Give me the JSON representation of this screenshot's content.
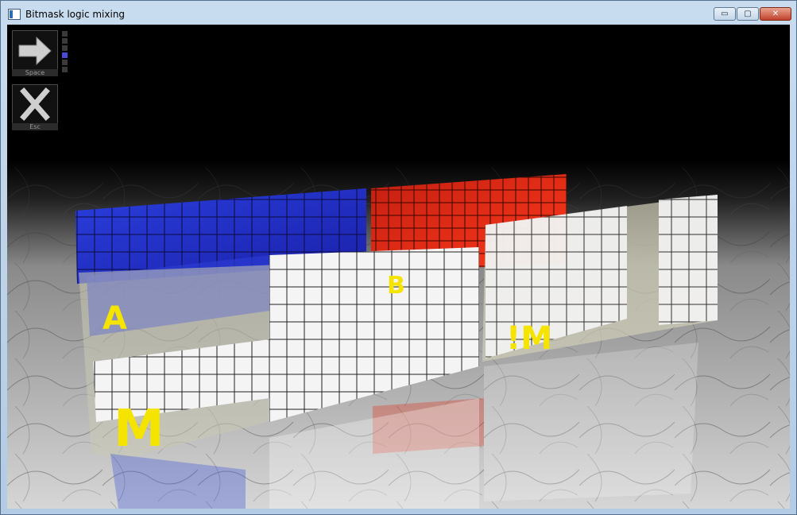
{
  "window": {
    "title": "Bitmask logic mixing",
    "controls": {
      "minimize": "▭",
      "maximize": "▢",
      "close": "✕"
    }
  },
  "hud": {
    "space_button": {
      "label": "Space",
      "icon": "arrow-right-icon"
    },
    "esc_button": {
      "label": "Esc",
      "icon": "close-x-icon"
    },
    "mode_indicator": {
      "count": 6,
      "active_index": 3,
      "active_color": "#4a4ad4"
    }
  },
  "scene": {
    "panels": [
      {
        "id": "A",
        "label": "A",
        "color": "#2433d6"
      },
      {
        "id": "B",
        "label": "B",
        "color": "#d8301b"
      },
      {
        "id": "M",
        "label": "M",
        "color": "#ffffff"
      },
      {
        "id": "notM",
        "label": "!M",
        "color": "#ffffff"
      }
    ],
    "label_color": "#f4e400",
    "floor": "marble"
  }
}
